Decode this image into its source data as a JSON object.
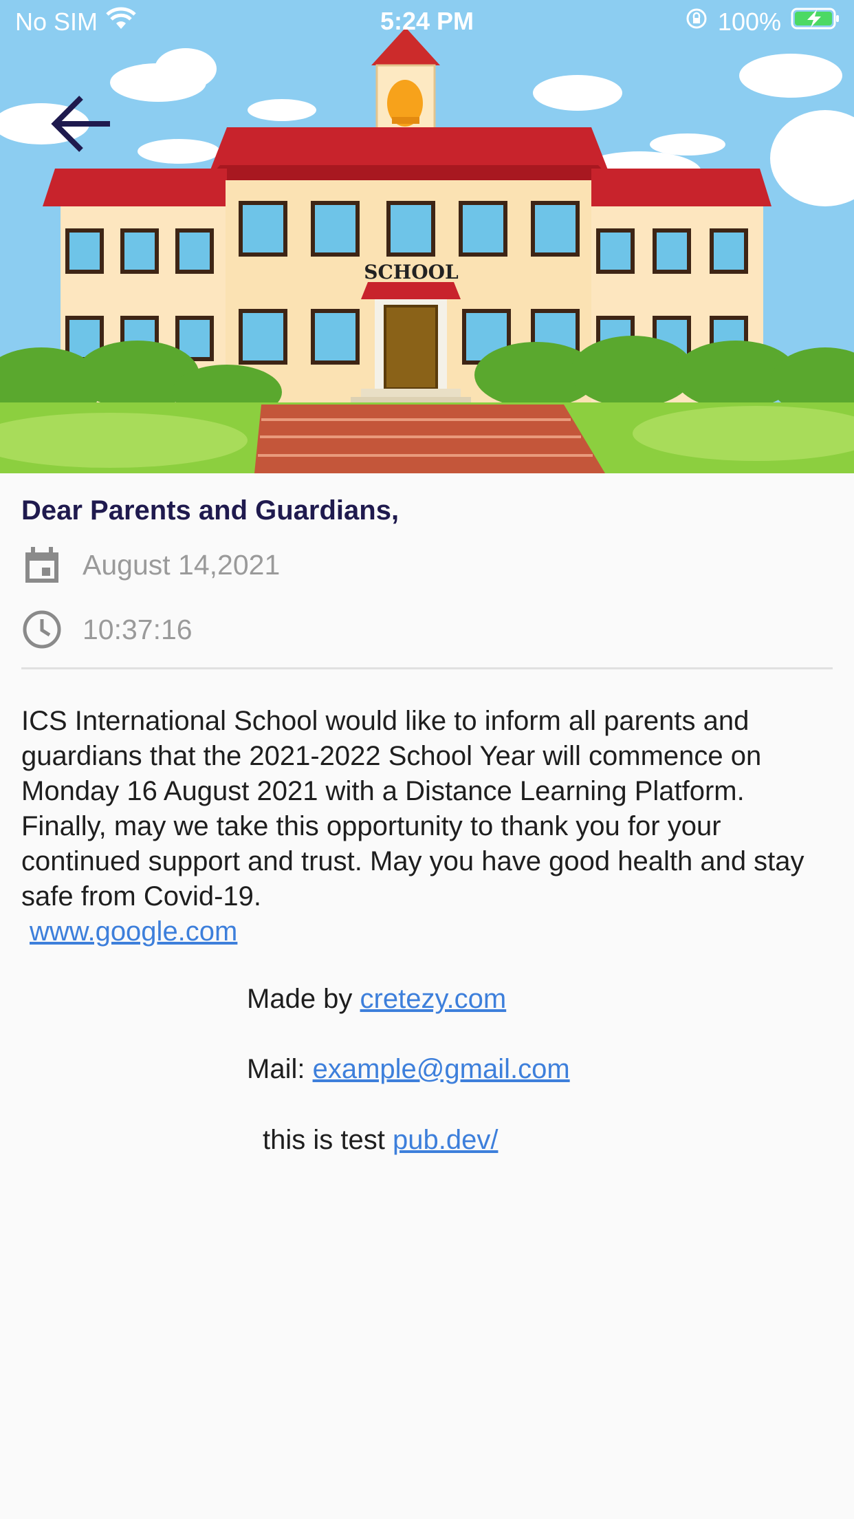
{
  "status_bar": {
    "carrier": "No SIM",
    "time": "5:24 PM",
    "battery": "100%",
    "icons": [
      "wifi-icon",
      "orientation-lock-icon",
      "battery-charging-icon"
    ]
  },
  "hero": {
    "sign_text": "SCHOOL",
    "back_icon": "arrow-left-icon"
  },
  "notice": {
    "title": "Dear Parents and Guardians,",
    "date": "August 14,2021",
    "date_icon": "calendar-icon",
    "time": "10:37:16",
    "time_icon": "clock-icon",
    "paragraph_1": "ICS International School would like to inform all parents and guardians that the 2021-2022 School Year will commence on Monday 16 August 2021 with a Distance Learning Platform.",
    "paragraph_2": "Finally, may we take this opportunity to thank you for your continued support and trust. May you have good health and stay safe from Covid-19.",
    "link": "www.google.com"
  },
  "footer": {
    "made_by_label": "Made by",
    "made_by_link": "cretezy.com",
    "mail_label": "Mail:",
    "mail_link": "example@gmail.com",
    "test_label": "this is test",
    "test_link": "pub.dev/"
  },
  "colors": {
    "heading": "#1f1a4e",
    "link": "#3d7fdb",
    "meta_text": "#9a9a9a",
    "background": "#fafafa"
  }
}
